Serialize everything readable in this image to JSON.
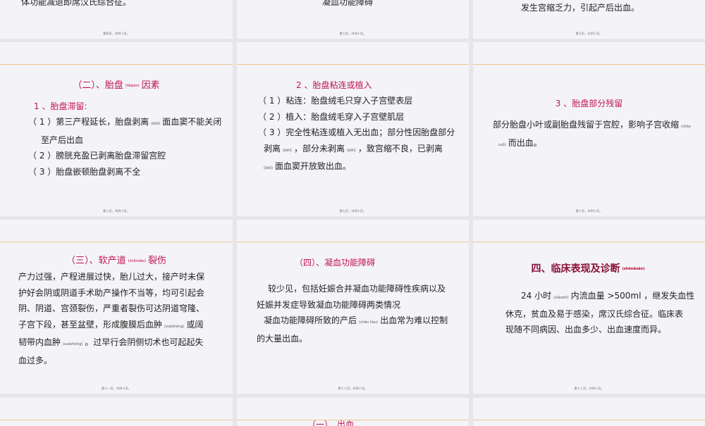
{
  "footer_text": "第四页，共四十页。",
  "row1": {
    "s1_text": "体功能减退即席汉氏综合征。",
    "s2_text": "凝血功能障碍",
    "s3_text": "发生宫缩乏力，引起产后出血。",
    "footers": [
      "第四页，共四十页。",
      "第六页，共四十页。",
      "第七页，共四十页。"
    ]
  },
  "row2": {
    "s1": {
      "title_pre": "（二）、胎盘",
      "title_ruby": "(tāipán)",
      "title_post": "因素",
      "sub": "1 、胎盘滞留:",
      "l1_pre": "（ 1 ）第三产程延长，胎盘剥离",
      "l1_ruby": "(bōlí)",
      "l1_post": "面血窦不能关闭",
      "l2": "至产后出血",
      "l3": "（ 2 ）膀胱充盈已剥离胎盘滞留宫腔",
      "l4": "（ 3 ）胎盘嵌顿胎盘剥离不全",
      "footer": "第八页，共四十页。"
    },
    "s2": {
      "title": "2 、胎盘粘连或植入",
      "l1": "（ 1 ）粘连：胎盘绒毛只穿入子宫壁表层",
      "l2": "（ 2 ）植入：胎盘绒毛穿入子宫壁肌层",
      "l3": "（ 3 ）完全性粘连或植入无出血；部分性因胎盘部分",
      "l4_a": "剥离",
      "l4_ruby1": "(bōlí)",
      "l4_b": "，部分未剥离",
      "l4_ruby2": "(bōlí)",
      "l4_c": "，致宫缩不良，已剥离",
      "l5_ruby": "(bōlí)",
      "l5_post": "面血窦开放致出血。",
      "footer": "第九页，共四十页。"
    },
    "s3": {
      "title": "3 、胎盘部分残留",
      "l1_pre": "部分胎盘小叶或副胎盘残留于宫腔，影响子宫收缩",
      "l1_ruby": "(shōu",
      "l2_ruby": "suō)",
      "l2_post": "而出血。",
      "footer": "第十页，共四十页。"
    }
  },
  "row3": {
    "s1": {
      "title_pre": "（三）、软产道",
      "title_ruby": "(chǎndào)",
      "title_post": "裂伤",
      "l1": "产力过强，产程进展过快，胎儿过大，接产时未保",
      "l2": "护好会阴或阴道手术助产操作不当等，均可引起会",
      "l3": "阴、阴道、宫颈裂伤，严重者裂伤可达阴道穹隆、",
      "l4_pre": "子宫下段，甚至盆壁，形成腹膜后血肿",
      "l4_ruby": "(xuèzhǒng)",
      "l4_post": "或阔",
      "l5_pre": "韧带内血肿",
      "l5_ruby": "(xuèzhǒng)",
      "l5_post": "。过早行会阴侧切术也可起起失",
      "l6": "血过多。",
      "footer": "第十一页，共四十页。"
    },
    "s2": {
      "title": "（四）、凝血功能障碍",
      "l1": "较少见，包括妊娠合并凝血功能障碍性疾病以及",
      "l2": "妊娠并发症导致凝血功能障碍两类情况",
      "l3_pre": "凝血功能障碍所致的产后",
      "l3_ruby": "(chǎn hòu)",
      "l3_post": "出血常为难以控制",
      "l4": "的大量出血。",
      "footer": "第十二页，共四十页。"
    },
    "s3": {
      "title_pre": "四、临床表现及诊断",
      "title_ruby": "(zhěnduàn)",
      "l1_pre": "24 小时",
      "l1_ruby": "(xiǎoshí)",
      "l1_post": "内流血量 >500ml ，继发失血性",
      "l2": "休克，贫血及易于感染，席汉氏综合征。临床表",
      "l3": "现随不同病因、出血多少、出血速度而异。",
      "footer": "第十三页，共四十页。"
    }
  },
  "row4": {
    "s2_title_partial": "（一）、出血"
  }
}
